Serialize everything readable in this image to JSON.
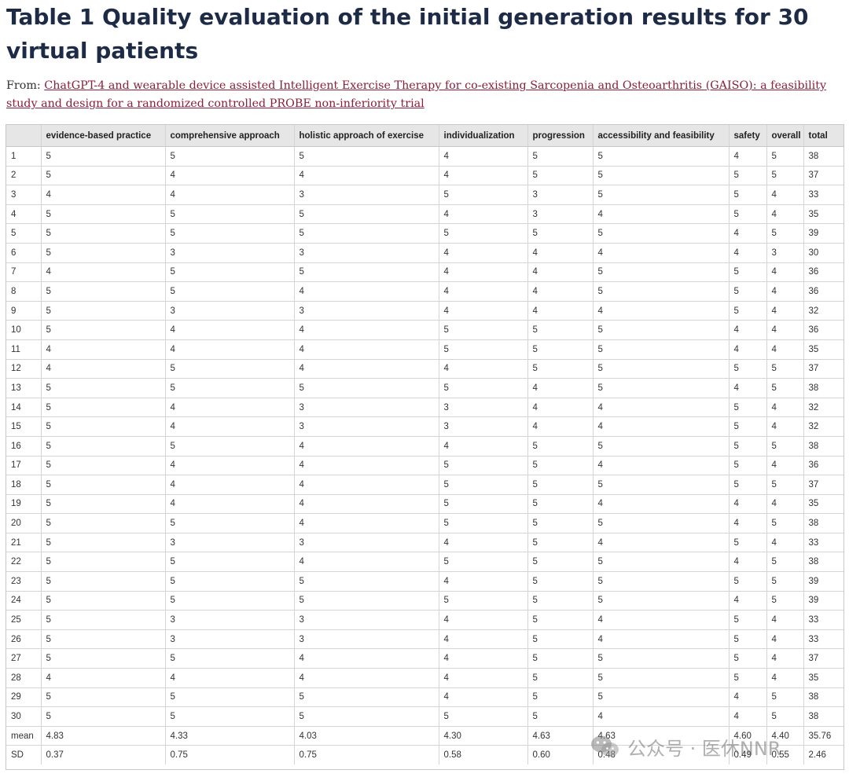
{
  "title": "Table 1 Quality evaluation of the initial generation results for 30 virtual patients",
  "from_prefix": "From: ",
  "from_link": "ChatGPT-4 and wearable device assisted Intelligent Exercise Therapy for co-existing Sarcopenia and Osteoarthritis (GAISO): a feasibility study and design for a randomized controlled PROBE non-inferiority trial",
  "table": {
    "headers": [
      "",
      "evidence-based practice",
      "comprehensive approach",
      "holistic approach of exercise",
      "individualization",
      "progression",
      "accessibility and feasibility",
      "safety",
      "overall",
      "total"
    ],
    "rows": [
      [
        "1",
        "5",
        "5",
        "5",
        "4",
        "5",
        "5",
        "4",
        "5",
        "38"
      ],
      [
        "2",
        "5",
        "4",
        "4",
        "4",
        "5",
        "5",
        "5",
        "5",
        "37"
      ],
      [
        "3",
        "4",
        "4",
        "3",
        "5",
        "3",
        "5",
        "5",
        "4",
        "33"
      ],
      [
        "4",
        "5",
        "5",
        "5",
        "4",
        "3",
        "4",
        "5",
        "4",
        "35"
      ],
      [
        "5",
        "5",
        "5",
        "5",
        "5",
        "5",
        "5",
        "4",
        "5",
        "39"
      ],
      [
        "6",
        "5",
        "3",
        "3",
        "4",
        "4",
        "4",
        "4",
        "3",
        "30"
      ],
      [
        "7",
        "4",
        "5",
        "5",
        "4",
        "4",
        "5",
        "5",
        "4",
        "36"
      ],
      [
        "8",
        "5",
        "5",
        "4",
        "4",
        "4",
        "5",
        "5",
        "4",
        "36"
      ],
      [
        "9",
        "5",
        "3",
        "3",
        "4",
        "4",
        "4",
        "5",
        "4",
        "32"
      ],
      [
        "10",
        "5",
        "4",
        "4",
        "5",
        "5",
        "5",
        "4",
        "4",
        "36"
      ],
      [
        "11",
        "4",
        "4",
        "4",
        "5",
        "5",
        "5",
        "4",
        "4",
        "35"
      ],
      [
        "12",
        "4",
        "5",
        "4",
        "4",
        "5",
        "5",
        "5",
        "5",
        "37"
      ],
      [
        "13",
        "5",
        "5",
        "5",
        "5",
        "4",
        "5",
        "4",
        "5",
        "38"
      ],
      [
        "14",
        "5",
        "4",
        "3",
        "3",
        "4",
        "4",
        "5",
        "4",
        "32"
      ],
      [
        "15",
        "5",
        "4",
        "3",
        "3",
        "4",
        "4",
        "5",
        "4",
        "32"
      ],
      [
        "16",
        "5",
        "5",
        "4",
        "4",
        "5",
        "5",
        "5",
        "5",
        "38"
      ],
      [
        "17",
        "5",
        "4",
        "4",
        "5",
        "5",
        "4",
        "5",
        "4",
        "36"
      ],
      [
        "18",
        "5",
        "4",
        "4",
        "5",
        "5",
        "5",
        "5",
        "5",
        "37"
      ],
      [
        "19",
        "5",
        "4",
        "4",
        "5",
        "5",
        "4",
        "4",
        "4",
        "35"
      ],
      [
        "20",
        "5",
        "5",
        "4",
        "5",
        "5",
        "5",
        "4",
        "5",
        "38"
      ],
      [
        "21",
        "5",
        "3",
        "3",
        "4",
        "5",
        "4",
        "5",
        "4",
        "33"
      ],
      [
        "22",
        "5",
        "5",
        "4",
        "5",
        "5",
        "5",
        "4",
        "5",
        "38"
      ],
      [
        "23",
        "5",
        "5",
        "5",
        "4",
        "5",
        "5",
        "5",
        "5",
        "39"
      ],
      [
        "24",
        "5",
        "5",
        "5",
        "5",
        "5",
        "5",
        "4",
        "5",
        "39"
      ],
      [
        "25",
        "5",
        "3",
        "3",
        "4",
        "5",
        "4",
        "5",
        "4",
        "33"
      ],
      [
        "26",
        "5",
        "3",
        "3",
        "4",
        "5",
        "4",
        "5",
        "4",
        "33"
      ],
      [
        "27",
        "5",
        "5",
        "4",
        "4",
        "5",
        "5",
        "5",
        "4",
        "37"
      ],
      [
        "28",
        "4",
        "4",
        "4",
        "4",
        "5",
        "5",
        "5",
        "4",
        "35"
      ],
      [
        "29",
        "5",
        "5",
        "5",
        "4",
        "5",
        "5",
        "4",
        "5",
        "38"
      ],
      [
        "30",
        "5",
        "5",
        "5",
        "5",
        "5",
        "4",
        "4",
        "5",
        "38"
      ],
      [
        "mean",
        "4.83",
        "4.33",
        "4.03",
        "4.30",
        "4.63",
        "4.63",
        "4.60",
        "4.40",
        "35.76"
      ],
      [
        "SD",
        "0.37",
        "0.75",
        "0.75",
        "0.58",
        "0.60",
        "0.48",
        "0.49",
        "0.55",
        "2.46"
      ]
    ]
  },
  "watermark": {
    "text": "公众号 · 医休NNR",
    "logo_icon": "wechat-logo-icon"
  }
}
